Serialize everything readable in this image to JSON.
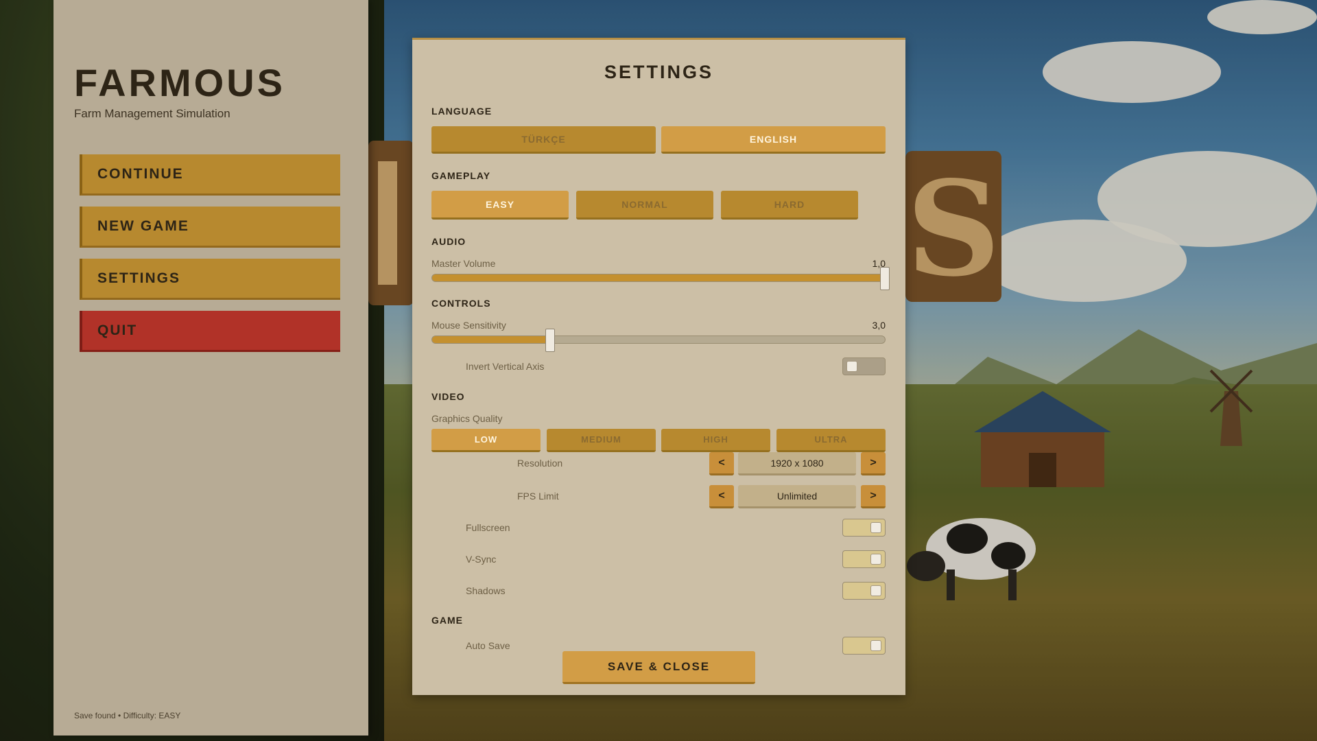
{
  "menu": {
    "title": "FARMOUS",
    "subtitle": "Farm Management Simulation",
    "items": [
      {
        "label": "CONTINUE"
      },
      {
        "label": "NEW GAME"
      },
      {
        "label": "SETTINGS"
      },
      {
        "label": "QUIT"
      }
    ],
    "footer": "Save found  •  Difficulty: EASY"
  },
  "settings": {
    "title": "SETTINGS",
    "language": {
      "label": "LANGUAGE",
      "options": [
        "TÜRKÇE",
        "ENGLISH"
      ],
      "selected": "ENGLISH"
    },
    "gameplay": {
      "label": "GAMEPLAY",
      "options": [
        "EASY",
        "NORMAL",
        "HARD"
      ],
      "selected": "EASY"
    },
    "audio": {
      "label": "AUDIO",
      "master_volume": {
        "label": "Master Volume",
        "value_text": "1,0",
        "fraction": 1.0
      }
    },
    "controls": {
      "label": "CONTROLS",
      "mouse_sensitivity": {
        "label": "Mouse Sensitivity",
        "value_text": "3,0",
        "fraction": 0.26
      },
      "invert_vertical": {
        "label": "Invert Vertical Axis",
        "on": false
      }
    },
    "video": {
      "label": "VIDEO",
      "quality": {
        "label": "Graphics Quality",
        "options": [
          "LOW",
          "MEDIUM",
          "HIGH",
          "ULTRA"
        ],
        "selected": "LOW"
      },
      "resolution": {
        "label": "Resolution",
        "value": "1920 x 1080",
        "prev": "<",
        "next": ">"
      },
      "fps_limit": {
        "label": "FPS Limit",
        "value": "Unlimited",
        "prev": "<",
        "next": ">"
      },
      "fullscreen": {
        "label": "Fullscreen",
        "on": true
      },
      "vsync": {
        "label": "V-Sync",
        "on": true
      },
      "shadows": {
        "label": "Shadows",
        "on": true
      }
    },
    "game": {
      "label": "GAME",
      "auto_save": {
        "label": "Auto Save",
        "on": true
      }
    },
    "save_label": "SAVE & CLOSE"
  },
  "colors": {
    "accent": "#b7892f",
    "accent_selected": "#d29d46",
    "quit": "#b13228",
    "panel": "#ccbfa6",
    "menu_panel": "#b7ab95"
  }
}
